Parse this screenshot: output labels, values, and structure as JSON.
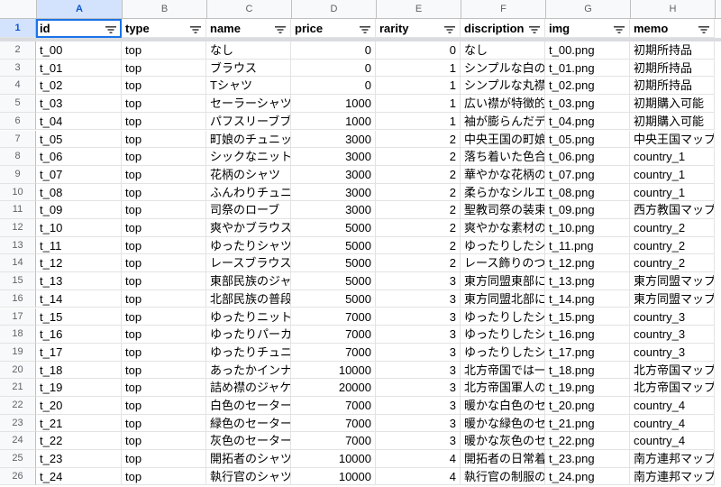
{
  "columns": [
    "A",
    "B",
    "C",
    "D",
    "E",
    "F",
    "G",
    "H"
  ],
  "headers": [
    "id",
    "type",
    "name",
    "price",
    "rarity",
    "discription",
    "img",
    "memo"
  ],
  "rows": [
    {
      "n": "2",
      "c": [
        "t_00",
        "top",
        "なし",
        "0",
        "0",
        "なし",
        "t_00.png",
        "初期所持品"
      ]
    },
    {
      "n": "3",
      "c": [
        "t_01",
        "top",
        "ブラウス",
        "0",
        "1",
        "シンプルな白の",
        "t_01.png",
        "初期所持品"
      ]
    },
    {
      "n": "4",
      "c": [
        "t_02",
        "top",
        "Tシャツ",
        "0",
        "1",
        "シンプルな丸襟",
        "t_02.png",
        "初期所持品"
      ]
    },
    {
      "n": "5",
      "c": [
        "t_03",
        "top",
        "セーラーシャツ",
        "1000",
        "1",
        "広い襟が特徴的",
        "t_03.png",
        "初期購入可能"
      ]
    },
    {
      "n": "6",
      "c": [
        "t_04",
        "top",
        "パフスリーブブ",
        "1000",
        "1",
        "袖が膨らんだデ",
        "t_04.png",
        "初期購入可能"
      ]
    },
    {
      "n": "7",
      "c": [
        "t_05",
        "top",
        "町娘のチュニッ",
        "3000",
        "2",
        "中央王国の町娘",
        "t_05.png",
        "中央王国マップ"
      ]
    },
    {
      "n": "8",
      "c": [
        "t_06",
        "top",
        "シックなニット",
        "3000",
        "2",
        "落ち着いた色合",
        "t_06.png",
        "country_1"
      ]
    },
    {
      "n": "9",
      "c": [
        "t_07",
        "top",
        "花柄のシャツ",
        "3000",
        "2",
        "華やかな花柄の",
        "t_07.png",
        "country_1"
      ]
    },
    {
      "n": "10",
      "c": [
        "t_08",
        "top",
        "ふんわりチュニ",
        "3000",
        "2",
        "柔らかなシルエ",
        "t_08.png",
        "country_1"
      ]
    },
    {
      "n": "11",
      "c": [
        "t_09",
        "top",
        "司祭のローブ",
        "3000",
        "2",
        "聖教司祭の装束",
        "t_09.png",
        "西方教国マップ"
      ]
    },
    {
      "n": "12",
      "c": [
        "t_10",
        "top",
        "爽やかブラウス",
        "5000",
        "2",
        "爽やかな素材の",
        "t_10.png",
        "country_2"
      ]
    },
    {
      "n": "13",
      "c": [
        "t_11",
        "top",
        "ゆったりシャツ",
        "5000",
        "2",
        "ゆったりしたシ",
        "t_11.png",
        "country_2"
      ]
    },
    {
      "n": "14",
      "c": [
        "t_12",
        "top",
        "レースブラウス",
        "5000",
        "2",
        "レース飾りのつ",
        "t_12.png",
        "country_2"
      ]
    },
    {
      "n": "15",
      "c": [
        "t_13",
        "top",
        "東部民族のジャ",
        "5000",
        "3",
        "東方同盟東部に",
        "t_13.png",
        "東方同盟マップ"
      ]
    },
    {
      "n": "16",
      "c": [
        "t_14",
        "top",
        "北部民族の普段",
        "5000",
        "3",
        "東方同盟北部に",
        "t_14.png",
        "東方同盟マップ"
      ]
    },
    {
      "n": "17",
      "c": [
        "t_15",
        "top",
        "ゆったりニット",
        "7000",
        "3",
        "ゆったりしたシ",
        "t_15.png",
        "country_3"
      ]
    },
    {
      "n": "18",
      "c": [
        "t_16",
        "top",
        "ゆったりパーカ",
        "7000",
        "3",
        "ゆったりしたシ",
        "t_16.png",
        "country_3"
      ]
    },
    {
      "n": "19",
      "c": [
        "t_17",
        "top",
        "ゆったりチュニ",
        "7000",
        "3",
        "ゆったりしたシ",
        "t_17.png",
        "country_3"
      ]
    },
    {
      "n": "20",
      "c": [
        "t_18",
        "top",
        "あったかインナ",
        "10000",
        "3",
        "北方帝国では一",
        "t_18.png",
        "北方帝国マップ"
      ]
    },
    {
      "n": "21",
      "c": [
        "t_19",
        "top",
        "詰め襟のジャケ",
        "20000",
        "3",
        "北方帝国軍人の",
        "t_19.png",
        "北方帝国マップ"
      ]
    },
    {
      "n": "22",
      "c": [
        "t_20",
        "top",
        "白色のセーター",
        "7000",
        "3",
        "暖かな白色のセ",
        "t_20.png",
        "country_4"
      ]
    },
    {
      "n": "23",
      "c": [
        "t_21",
        "top",
        "緑色のセーター",
        "7000",
        "3",
        "暖かな緑色のセ",
        "t_21.png",
        "country_4"
      ]
    },
    {
      "n": "24",
      "c": [
        "t_22",
        "top",
        "灰色のセーター",
        "7000",
        "3",
        "暖かな灰色のセ",
        "t_22.png",
        "country_4"
      ]
    },
    {
      "n": "25",
      "c": [
        "t_23",
        "top",
        "開拓者のシャツ",
        "10000",
        "4",
        "開拓者の日常着",
        "t_23.png",
        "南方連邦マップ"
      ]
    },
    {
      "n": "26",
      "c": [
        "t_24",
        "top",
        "執行官のシャツ",
        "10000",
        "4",
        "執行官の制服の",
        "t_24.png",
        "南方連邦マップ"
      ]
    }
  ],
  "colors": {
    "accent": "#1a73e8",
    "header_bg": "#f8f9fa",
    "selected_header": "#d3e3fd",
    "grid": "#e2e3e3"
  },
  "icons": {
    "filter": "filter-icon"
  }
}
